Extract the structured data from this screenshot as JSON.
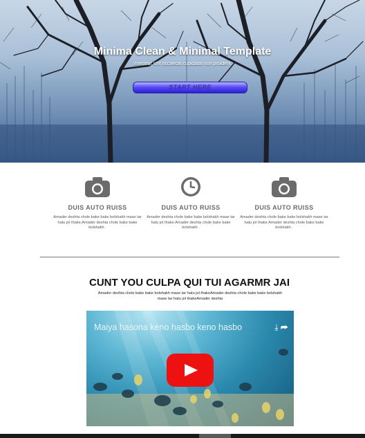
{
  "hero": {
    "title": "Minima Clean & Minimal Template",
    "subtitle": "exerteur sint occaecat cupidatat non proident",
    "button_label": "START HERE"
  },
  "features": [
    {
      "icon": "camera-icon",
      "title": "DUIS AUTO RUISS",
      "desc": "Amader deshta chole bake bake bolshakh mase tar hatu jol thake.Amader deshta chole bake bake bolshakh ."
    },
    {
      "icon": "clock-icon",
      "title": "DUIS AUTO RUISS",
      "desc": "Amader deshta chole bake bake bolshakh mase tar hatu jol thake.Amader deshta chole bake bake bolshakh ."
    },
    {
      "icon": "camera-icon",
      "title": "DUIS AUTO RUISS",
      "desc": "Amader deshta chole bake bake bolshakh mase tar hatu jol thake.Amader deshta chole bake bake bolshakh ."
    }
  ],
  "section": {
    "title": "CUNT YOU CULPA QUI TUI AGARMR JAI",
    "desc": "Amader deshta chole bake bake bolshakh mase tar hatu jol thakeAmader deshta chole bake bake bolshakh mase tar hatu jol thakeAmader deshta"
  },
  "video": {
    "title": "Maiya hasona keno hasbo keno hasbo",
    "actions": "⤓ ➦"
  },
  "colors": {
    "button": "#4a3ef0",
    "play": "#ee1111"
  }
}
